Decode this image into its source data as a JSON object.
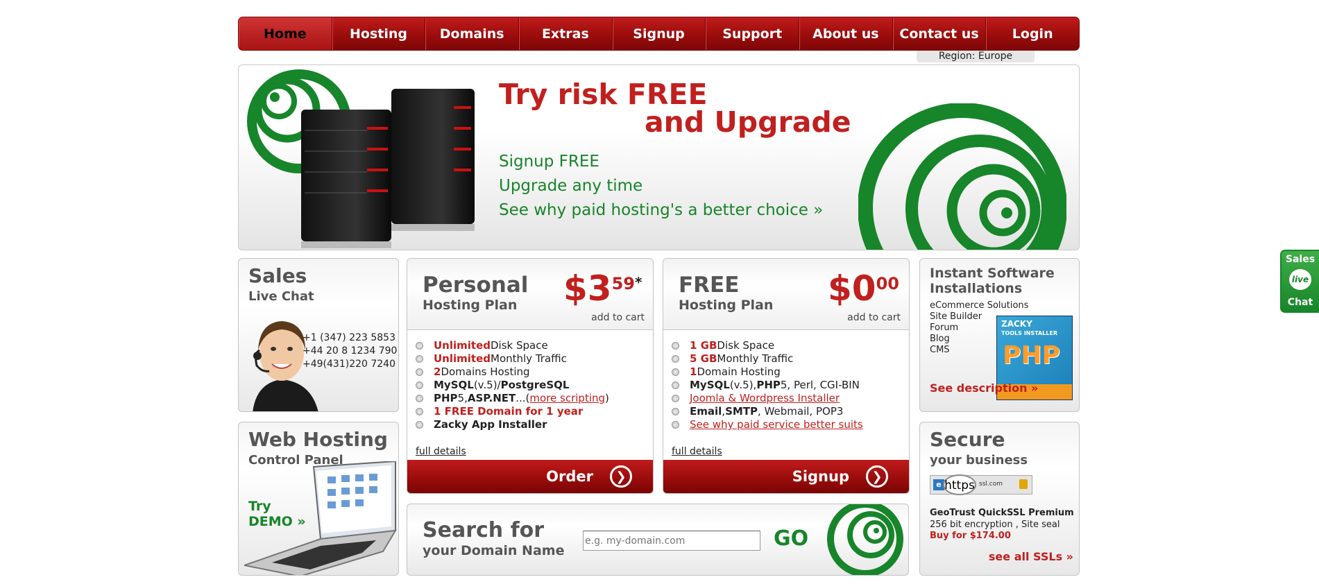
{
  "nav": {
    "items": [
      "Home",
      "Hosting",
      "Domains",
      "Extras",
      "Signup",
      "Support",
      "About us",
      "Contact us",
      "Login"
    ],
    "active": "Home"
  },
  "region": "Region: Europe",
  "hero": {
    "title1": "Try risk FREE",
    "title2": "and Upgrade",
    "lines": [
      "Signup FREE",
      "Upgrade any time",
      "See why paid hosting's a better choice »"
    ]
  },
  "sales": {
    "title": "Sales",
    "subtitle": "Live Chat",
    "phones": [
      "+1 (347) 223 5853",
      "+44 20 8 1234 790",
      "+49(431)220 7240"
    ]
  },
  "personal": {
    "name": "Personal",
    "sub": "Hosting Plan",
    "price_main": "$3",
    "price_cents": "59",
    "price_note": "*",
    "add_to_cart": "add to cart",
    "features": [
      {
        "a": "Unlimited",
        "b": " Disk Space"
      },
      {
        "a": "Unlimited",
        "b": " Monthly Traffic"
      },
      {
        "a": "2",
        "b": " Domains Hosting"
      },
      {
        "a": "MySQL",
        "b": "(v.5)/",
        "c": "PostgreSQL"
      },
      {
        "a": "PHP",
        "b": "5, ",
        "c": "ASP.NET",
        "d": "...(",
        "e": "more scripting",
        "f": ")"
      },
      {
        "a": "1 FREE Domain for 1 year"
      },
      {
        "a": "Zacky App Installer"
      }
    ],
    "details": "full details",
    "button": "Order"
  },
  "free": {
    "name": "FREE",
    "sub": "Hosting Plan",
    "price_main": "$0",
    "price_cents": "00",
    "add_to_cart": "add to cart",
    "features": [
      {
        "a": "1 GB",
        "b": " Disk Space"
      },
      {
        "a": "5 GB",
        "b": " Monthly Traffic"
      },
      {
        "a": "1",
        "b": " Domain Hosting"
      },
      {
        "a": "MySQL",
        "b": "(v.5), ",
        "c": "PHP",
        "d": "5, Perl, CGI-BIN"
      },
      {
        "a": "Joomla & Wordpress Installer"
      },
      {
        "a": "Email",
        "b": ", ",
        "c": "SMTP",
        "d": ", Webmail, POP3"
      },
      {
        "a": "See why paid service better suits"
      }
    ],
    "details": "full details",
    "button": "Signup"
  },
  "installs": {
    "title": "Instant Software Installations",
    "items": [
      "eCommerce Solutions",
      "Site Builder",
      "Forum",
      "Blog",
      "CMS"
    ],
    "see": "See description »",
    "box_text": [
      "ZACKY",
      "TOOLS INSTALLER",
      "PHP"
    ]
  },
  "cpanel": {
    "title": "Web Hosting",
    "subtitle": "Control Panel",
    "demo": [
      "Try",
      "DEMO »"
    ]
  },
  "search": {
    "title": "Search for",
    "subtitle": "your Domain Name",
    "placeholder": "e.g. my-domain.com",
    "go": "GO"
  },
  "ssl": {
    "title": "Secure",
    "subtitle": "your business",
    "badge": "https",
    "badge_url": "ssl.com",
    "product": "GeoTrust QuickSSL Premium",
    "desc": "256 bit encryption , Site seal",
    "buy": "Buy for $174.00",
    "see": "see all SSLs »"
  },
  "livechat": {
    "top": "Sales",
    "mid": "live",
    "bottom": "Chat"
  },
  "colors": {
    "brand_red": "#c0201e",
    "nav_red": "#9c0c0c",
    "green": "#17852a"
  }
}
